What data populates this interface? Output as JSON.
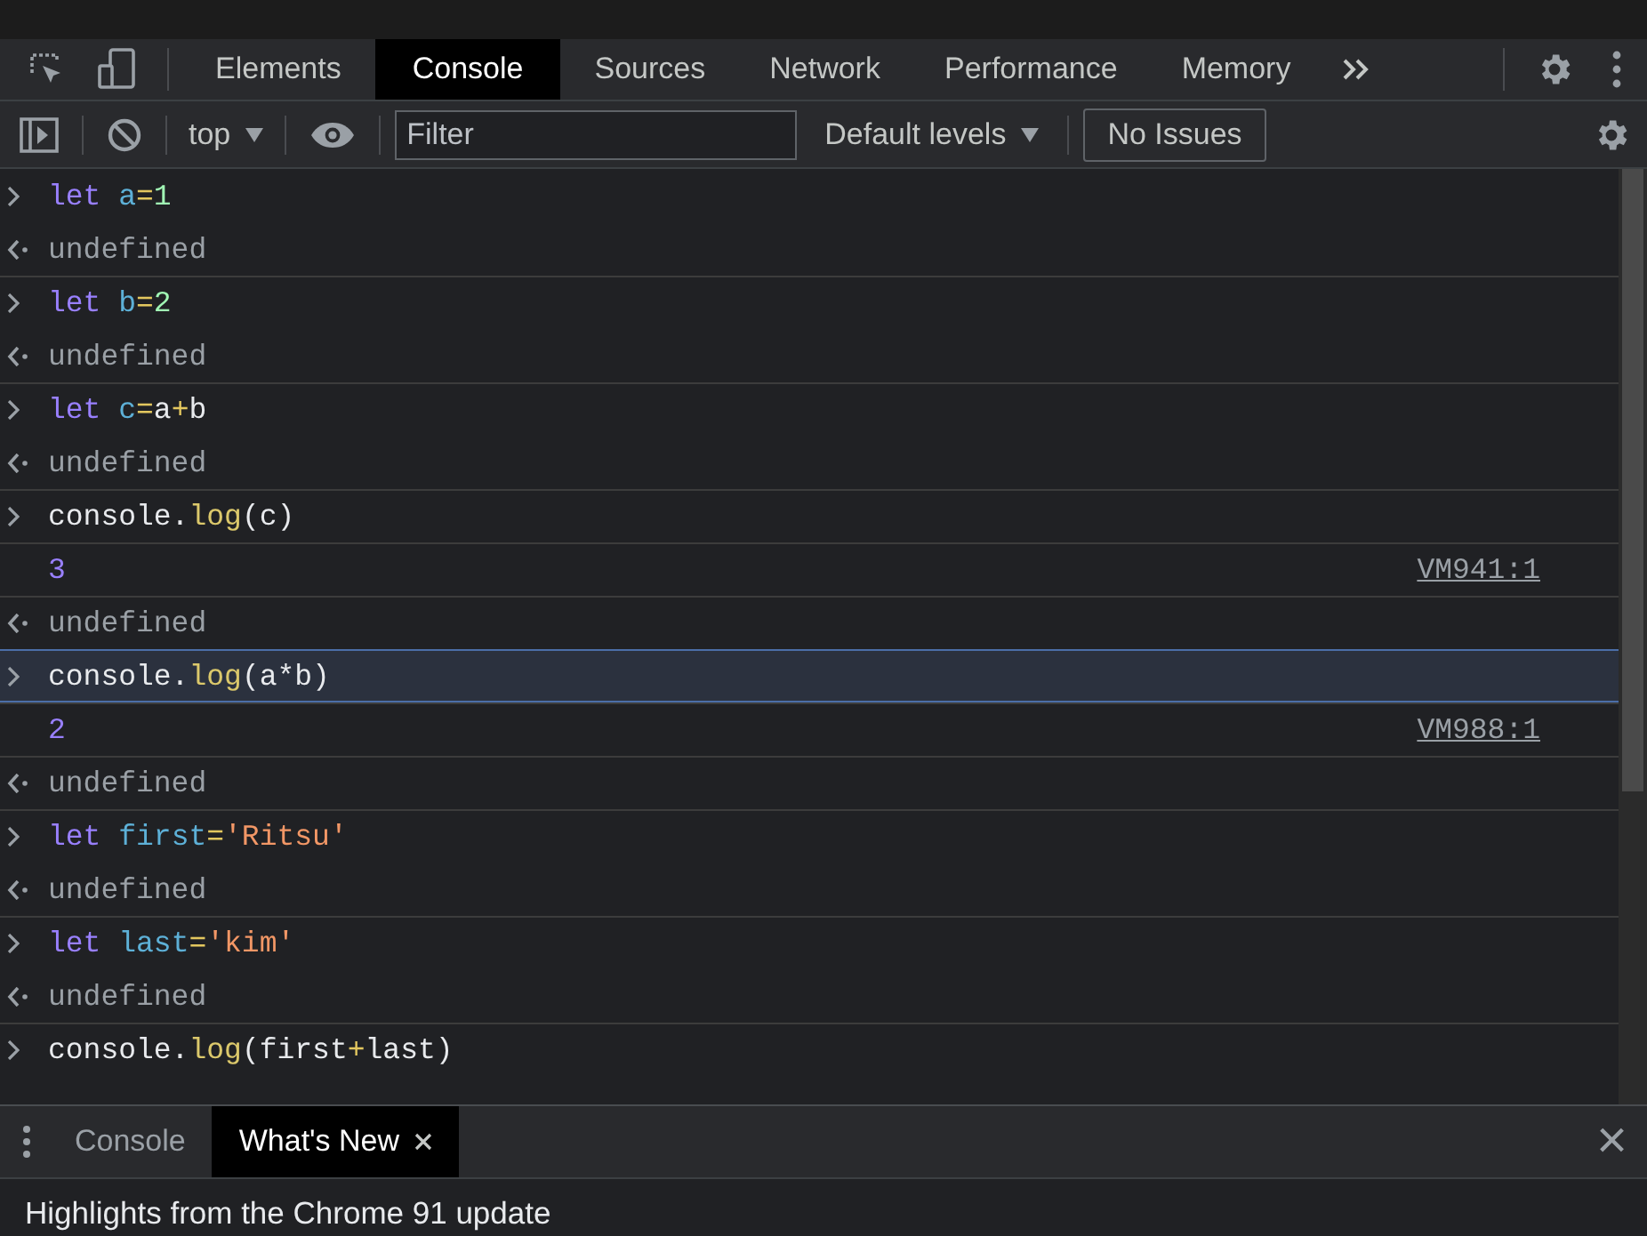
{
  "main_tabs": [
    {
      "label": "Elements",
      "selected": false
    },
    {
      "label": "Console",
      "selected": true
    },
    {
      "label": "Sources",
      "selected": false
    },
    {
      "label": "Network",
      "selected": false
    },
    {
      "label": "Performance",
      "selected": false
    },
    {
      "label": "Memory",
      "selected": false
    }
  ],
  "toolbar": {
    "context": "top",
    "filter": {
      "placeholder": "Filter"
    },
    "levels": "Default levels",
    "issues": "No Issues"
  },
  "entries": [
    {
      "kind": "input",
      "selected": false,
      "tokens": [
        {
          "kind": "keyword",
          "text": "let"
        },
        {
          "kind": "variable",
          "text": "a"
        },
        {
          "kind": "operator",
          "text": "="
        },
        {
          "kind": "number",
          "text": "1"
        }
      ]
    },
    {
      "kind": "return",
      "selected": false,
      "text": "undefined"
    },
    {
      "kind": "input",
      "selected": false,
      "tokens": [
        {
          "kind": "keyword",
          "text": "let"
        },
        {
          "kind": "variable",
          "text": "b"
        },
        {
          "kind": "operator",
          "text": "="
        },
        {
          "kind": "number",
          "text": "2"
        }
      ]
    },
    {
      "kind": "return",
      "selected": false,
      "text": "undefined"
    },
    {
      "kind": "input",
      "selected": false,
      "tokens": [
        {
          "kind": "keyword",
          "text": "let"
        },
        {
          "kind": "variable",
          "text": "c"
        },
        {
          "kind": "operator",
          "text": "="
        },
        {
          "kind": "plain",
          "text": "a"
        },
        {
          "kind": "operator",
          "text": "+"
        },
        {
          "kind": "plain",
          "text": "b"
        }
      ]
    },
    {
      "kind": "return",
      "selected": false,
      "text": "undefined"
    },
    {
      "kind": "input",
      "selected": false,
      "tokens": [
        {
          "kind": "plain",
          "text": "console."
        },
        {
          "kind": "method",
          "text": "log"
        },
        {
          "kind": "plain",
          "text": "(c)"
        }
      ]
    },
    {
      "kind": "log",
      "selected": false,
      "text": "3",
      "source": "VM941:1"
    },
    {
      "kind": "return",
      "selected": false,
      "text": "undefined"
    },
    {
      "kind": "input",
      "selected": true,
      "tokens": [
        {
          "kind": "plain",
          "text": "console."
        },
        {
          "kind": "method",
          "text": "log"
        },
        {
          "kind": "plain",
          "text": "(a*b)"
        }
      ]
    },
    {
      "kind": "log",
      "selected": false,
      "text": "2",
      "source": "VM988:1"
    },
    {
      "kind": "return",
      "selected": false,
      "text": "undefined"
    },
    {
      "kind": "input",
      "selected": false,
      "tokens": [
        {
          "kind": "keyword",
          "text": "let"
        },
        {
          "kind": "variable",
          "text": "first"
        },
        {
          "kind": "operator",
          "text": "="
        },
        {
          "kind": "string",
          "text": "'Ritsu'"
        }
      ]
    },
    {
      "kind": "return",
      "selected": false,
      "text": "undefined"
    },
    {
      "kind": "input",
      "selected": false,
      "tokens": [
        {
          "kind": "keyword",
          "text": "let"
        },
        {
          "kind": "variable",
          "text": "last"
        },
        {
          "kind": "operator",
          "text": "="
        },
        {
          "kind": "string",
          "text": "'kim'"
        }
      ]
    },
    {
      "kind": "return",
      "selected": false,
      "text": "undefined"
    },
    {
      "kind": "input",
      "selected": false,
      "tokens": [
        {
          "kind": "plain",
          "text": "console."
        },
        {
          "kind": "method",
          "text": "log"
        },
        {
          "kind": "plain",
          "text": "(first"
        },
        {
          "kind": "operator",
          "text": "+"
        },
        {
          "kind": "plain",
          "text": "last)"
        }
      ]
    }
  ],
  "drawer": {
    "tabs": [
      {
        "label": "Console",
        "selected": false,
        "closable": false
      },
      {
        "label": "What's New",
        "selected": true,
        "closable": true
      }
    ],
    "close": "×",
    "content": "Highlights from the Chrome 91 update"
  }
}
